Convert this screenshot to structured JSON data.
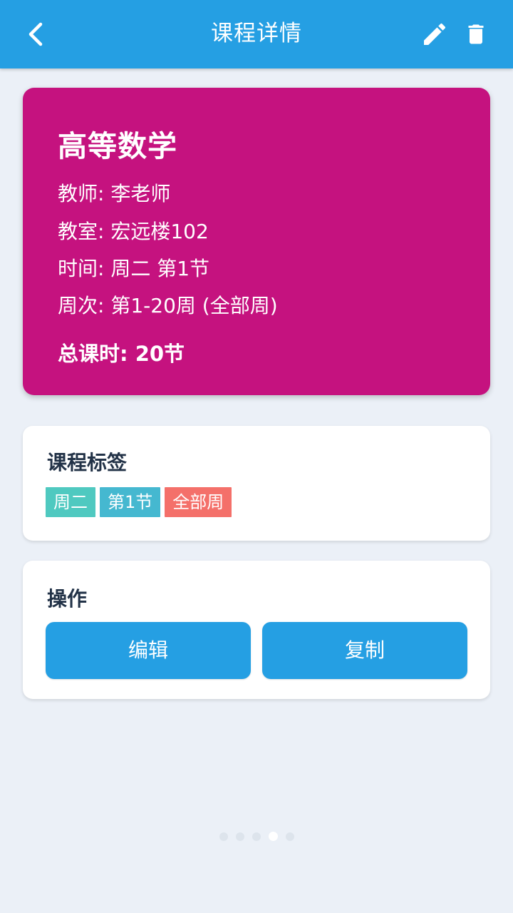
{
  "header": {
    "title": "课程详情",
    "back_icon": "chevron-left-icon",
    "edit_icon": "pencil-icon",
    "delete_icon": "trash-icon",
    "bar_color": "#259fe3"
  },
  "course": {
    "name": "高等数学",
    "teacher": "教师: 李老师",
    "classroom": "教室: 宏远楼102",
    "time": "时间: 周二 第1节",
    "weeks": "周次: 第1-20周 (全部周)",
    "total_hours": "总课时: 20节",
    "card_color": "#c5127f"
  },
  "tags_panel": {
    "heading": "课程标签",
    "tags": [
      {
        "label": "周二",
        "color": "#4fc9c0"
      },
      {
        "label": "第1节",
        "color": "#45b8d0"
      },
      {
        "label": "全部周",
        "color": "#f4706a"
      }
    ]
  },
  "actions_panel": {
    "heading": "操作",
    "edit_label": "编辑",
    "copy_label": "复制"
  },
  "pager": {
    "count": 5,
    "active_index": 3
  }
}
